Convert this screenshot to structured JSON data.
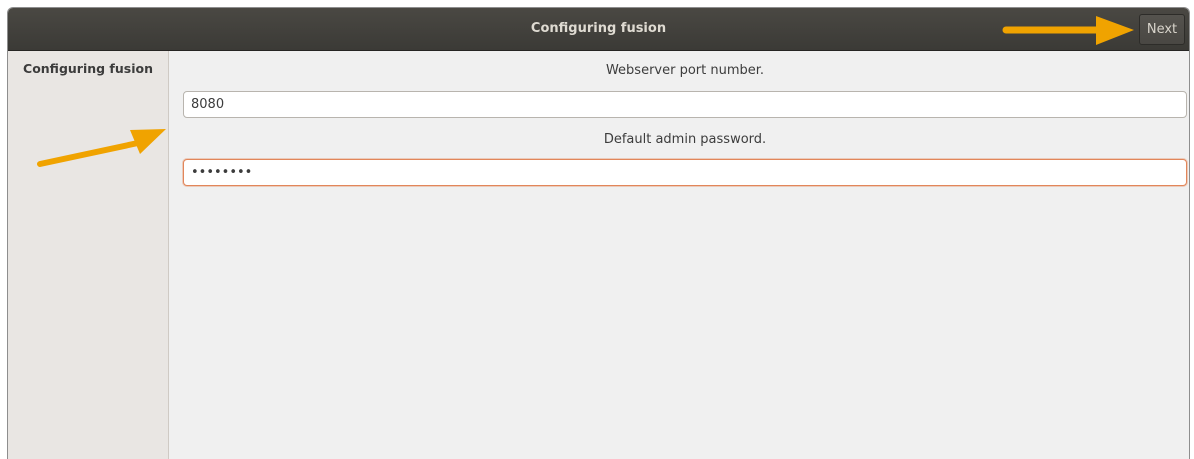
{
  "window": {
    "title": "Configuring fusion",
    "next_label": "Next"
  },
  "sidebar": {
    "items": [
      {
        "label": "Configuring fusion"
      }
    ]
  },
  "form": {
    "port_label": "Webserver port number.",
    "port_value": "8080",
    "password_label": "Default admin password.",
    "password_value": "password"
  },
  "colors": {
    "titlebar": "#3c3b37",
    "accent_focus": "#e2865a",
    "annotation_arrow": "#f0a300"
  }
}
